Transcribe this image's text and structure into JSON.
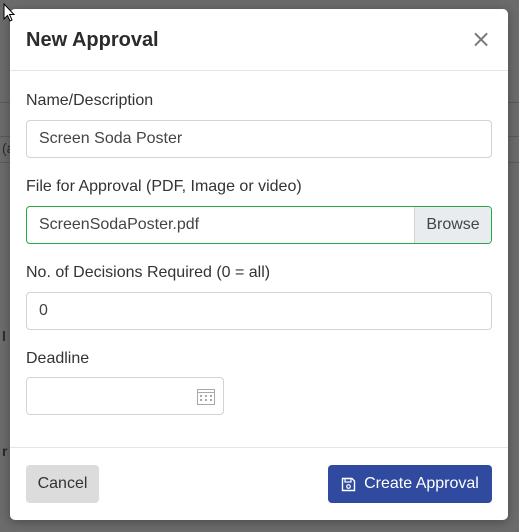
{
  "background": {
    "fragments": [
      "(a",
      "l",
      "r"
    ]
  },
  "modal": {
    "title": "New Approval",
    "close_glyph": "×"
  },
  "form": {
    "name": {
      "label": "Name/Description",
      "value": "Screen Soda Poster"
    },
    "file": {
      "label": "File for Approval (PDF, Image or video)",
      "filename": "ScreenSodaPoster.pdf",
      "browse_label": "Browse"
    },
    "decisions": {
      "label": "No. of Decisions Required (0 = all)",
      "value": "0"
    },
    "deadline": {
      "label": "Deadline",
      "value": ""
    }
  },
  "footer": {
    "cancel_label": "Cancel",
    "create_label": "Create Approval"
  },
  "colors": {
    "primary": "#2f4a9e",
    "valid_border": "#28a745",
    "cancel_bg": "#dcdcdc"
  },
  "icons": {
    "close": "close-icon",
    "calendar": "calendar-icon",
    "create": "floppy-disk-icon",
    "cursor": "mouse-pointer-icon"
  }
}
